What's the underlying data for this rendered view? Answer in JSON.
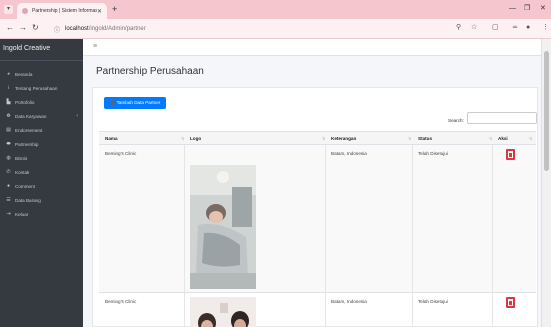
{
  "browser": {
    "tab_title": "Partnership | Sistem Informasi...",
    "url_host": "localhost",
    "url_path": "/ingold/Admin/partner"
  },
  "sidebar": {
    "brand": "Ingold Creative",
    "items": [
      {
        "label": "Beranda",
        "icon": "dashboard-icon"
      },
      {
        "label": "Tentang Perusahaan",
        "icon": "info-icon"
      },
      {
        "label": "Portofolio",
        "icon": "portfolio-icon"
      },
      {
        "label": "Data Karyawan",
        "icon": "users-icon",
        "has_caret": true
      },
      {
        "label": "Endorsement",
        "icon": "endorsement-icon"
      },
      {
        "label": "Partnership",
        "icon": "handshake-icon"
      },
      {
        "label": "Bisnis",
        "icon": "business-icon"
      },
      {
        "label": "Kontak",
        "icon": "phone-icon"
      },
      {
        "label": "Comment",
        "icon": "comment-icon"
      },
      {
        "label": "Data Barang",
        "icon": "list-icon"
      },
      {
        "label": "Keluar",
        "icon": "logout-icon"
      }
    ]
  },
  "main": {
    "page_title": "Partnership Perusahaan",
    "add_button": "Tambah Data Partner",
    "search_label": "Search:",
    "search_value": "",
    "columns": [
      "Nama",
      "Logo",
      "Keterangan",
      "Status",
      "Aksi"
    ],
    "rows": [
      {
        "nama": "Beming's Clinic",
        "keterangan": "Batam, Indonesia",
        "status": "Telah Disetujui"
      },
      {
        "nama": "Beming's Clinic",
        "keterangan": "Batam, Indonesia",
        "status": "Telah Disetujui"
      }
    ]
  },
  "colors": {
    "sidebar_bg": "#343a40",
    "primary": "#007bff",
    "danger": "#dc3545",
    "browser_frame": "#f6c6cf"
  }
}
